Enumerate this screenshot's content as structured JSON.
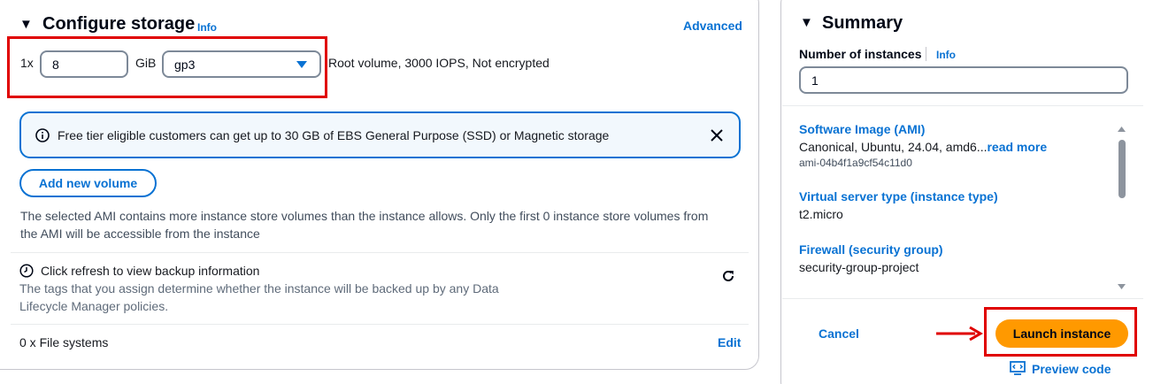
{
  "storage": {
    "title": "Configure storage",
    "info": "Info",
    "advanced": "Advanced",
    "volume_count": "1x",
    "size_value": "8",
    "size_unit": "GiB",
    "volume_type": "gp3",
    "volume_desc": "Root volume,  3000 IOPS,  Not encrypted",
    "alert_text": "Free tier eligible customers can get up to 30 GB of EBS General Purpose (SSD) or Magnetic storage",
    "add_volume": "Add new volume",
    "ami_note_1": "The selected AMI contains more instance store volumes than the instance allows. Only the first 0 instance store volumes from",
    "ami_note_2": "the AMI will be accessible from the instance",
    "backup_title": "Click refresh to view backup information",
    "backup_desc_1": "The tags that you assign determine whether the instance will be backed up by any Data",
    "backup_desc_2": "Lifecycle Manager policies.",
    "file_systems": "0 x File systems",
    "edit": "Edit"
  },
  "summary": {
    "title": "Summary",
    "instances_label": "Number of instances",
    "info": "Info",
    "instances_value": "1",
    "ami_label": "Software Image (AMI)",
    "ami_value": "Canonical, Ubuntu, 24.04, amd6...",
    "read_more": "read more",
    "ami_id": "ami-04b4f1a9cf54c11d0",
    "instance_type_label": "Virtual server type (instance type)",
    "instance_type_value": "t2.micro",
    "firewall_label": "Firewall (security group)",
    "firewall_value": "security-group-project",
    "cancel": "Cancel",
    "launch": "Launch instance",
    "preview": "Preview code"
  },
  "colors": {
    "link": "#0972d3",
    "launch_button": "#ff9900",
    "annotation_red": "#e00000",
    "alert_bg": "#f2f8fd"
  },
  "icons": [
    "caret-down-icon",
    "select-caret-icon",
    "info-circle-icon",
    "close-icon",
    "clock-icon",
    "refresh-icon",
    "scroll-up-icon",
    "scroll-down-icon",
    "annotation-arrow-icon",
    "preview-code-icon"
  ]
}
